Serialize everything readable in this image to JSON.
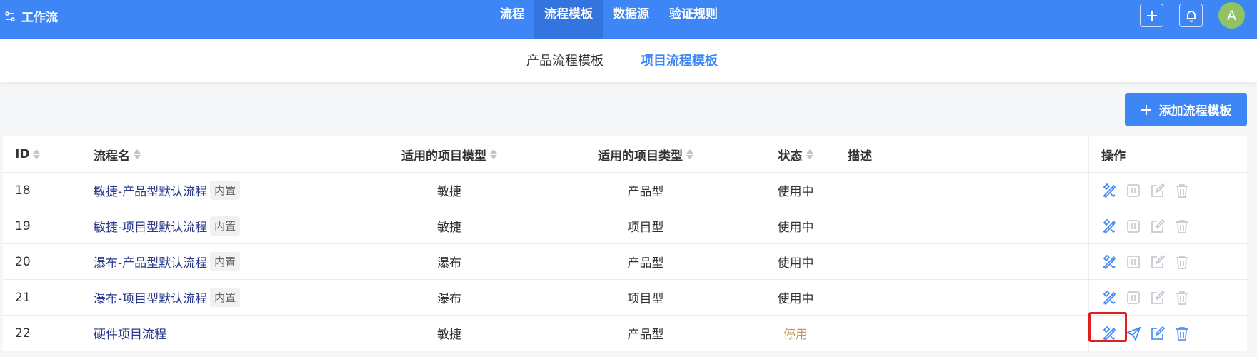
{
  "app": {
    "title": "工作流"
  },
  "topnav": [
    {
      "label": "流程",
      "active": false
    },
    {
      "label": "流程模板",
      "active": true
    },
    {
      "label": "数据源",
      "active": false
    },
    {
      "label": "验证规则",
      "active": false
    }
  ],
  "user": {
    "avatar_letter": "A"
  },
  "subtabs": [
    {
      "label": "产品流程模板",
      "active": false
    },
    {
      "label": "项目流程模板",
      "active": true
    }
  ],
  "add_button_label": "添加流程模板",
  "table": {
    "headers": {
      "id": "ID",
      "name": "流程名",
      "model": "适用的项目模型",
      "type": "适用的项目类型",
      "status": "状态",
      "desc": "描述",
      "ops": "操作"
    },
    "rows": [
      {
        "id": "18",
        "name": "敏捷-产品型默认流程",
        "tag": "内置",
        "model": "敏捷",
        "type": "产品型",
        "status": "使用中",
        "desc": ""
      },
      {
        "id": "19",
        "name": "敏捷-项目型默认流程",
        "tag": "内置",
        "model": "敏捷",
        "type": "项目型",
        "status": "使用中",
        "desc": ""
      },
      {
        "id": "20",
        "name": "瀑布-产品型默认流程",
        "tag": "内置",
        "model": "瀑布",
        "type": "产品型",
        "status": "使用中",
        "desc": ""
      },
      {
        "id": "21",
        "name": "瀑布-项目型默认流程",
        "tag": "内置",
        "model": "瀑布",
        "type": "项目型",
        "status": "使用中",
        "desc": ""
      },
      {
        "id": "22",
        "name": "硬件项目流程",
        "tag": "",
        "model": "敏捷",
        "type": "产品型",
        "status": "停用",
        "desc": ""
      }
    ]
  },
  "colors": {
    "primary": "#3e86f6",
    "disabled_icon": "#c0c4cc",
    "stop_status": "#c8955a",
    "highlight": "#e02020"
  }
}
